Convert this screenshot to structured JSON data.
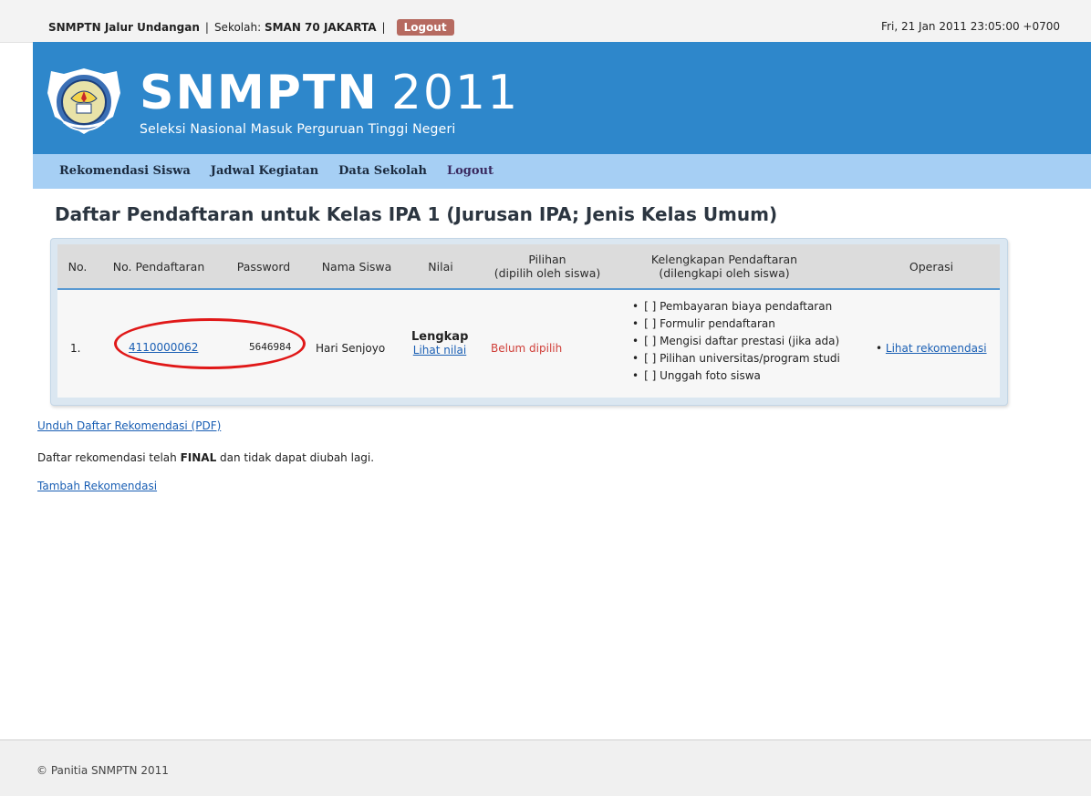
{
  "topbar": {
    "app_name": "SNMPTN Jalur Undangan",
    "separator": "|",
    "school_label": "Sekolah:",
    "school_name": "SMAN 70 JAKARTA",
    "logout_label": "Logout",
    "datetime": "Fri, 21 Jan 2011 23:05:00 +0700"
  },
  "header": {
    "title_bold": "SNMPTN",
    "title_year": "2011",
    "subtitle": "Seleksi Nasional Masuk Perguruan Tinggi Negeri",
    "seal_icon": "tut-wuri-handayani-seal"
  },
  "nav": {
    "items": [
      "Rekomendasi Siswa",
      "Jadwal Kegiatan",
      "Data Sekolah",
      "Logout"
    ]
  },
  "main": {
    "page_title": "Daftar Pendaftaran untuk Kelas IPA 1 (Jurusan IPA; Jenis Kelas Umum)",
    "table": {
      "headers": {
        "no": "No.",
        "reg_no": "No. Pendaftaran",
        "password": "Password",
        "name": "Nama Siswa",
        "score": "Nilai",
        "choice_line1": "Pilihan",
        "choice_line2": "(dipilih oleh siswa)",
        "completeness_line1": "Kelengkapan Pendaftaran",
        "completeness_line2": "(dilengkapi oleh siswa)",
        "operation": "Operasi"
      },
      "rows": [
        {
          "no": "1.",
          "reg_no": "4110000062",
          "password": "5646984",
          "name": "Hari Senjoyo",
          "score_status": "Lengkap",
          "score_link": "Lihat nilai",
          "choice": "Belum dipilih",
          "checklist": [
            "[  ] Pembayaran biaya pendaftaran",
            "[  ] Formulir pendaftaran",
            "[  ] Mengisi daftar prestasi (jika ada)",
            "[  ] Pilihan universitas/program studi",
            "[  ] Unggah foto siswa"
          ],
          "operation_link": "Lihat rekomendasi"
        }
      ]
    },
    "download_link": "Unduh Daftar Rekomendasi (PDF)",
    "final_text_before": "Daftar rekomendasi telah ",
    "final_text_bold": "FINAL",
    "final_text_after": " dan tidak dapat diubah lagi.",
    "add_link": "Tambah Rekomendasi"
  },
  "footer": {
    "copyright": "© Panitia SNMPTN 2011"
  },
  "colors": {
    "header_blue": "#2e87cb",
    "nav_blue": "#a6cff4",
    "logout_button": "#b66a60",
    "pending_red": "#d0403a",
    "annotation_ring": "#e01818"
  }
}
